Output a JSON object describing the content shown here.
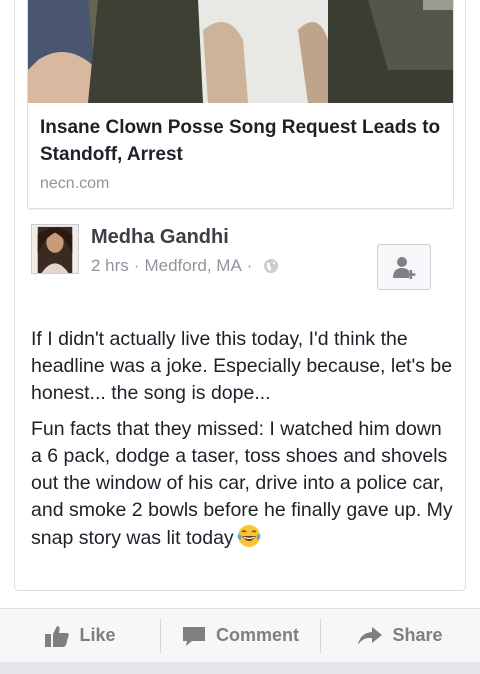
{
  "link_preview": {
    "title": "Insane Clown Posse Song Request Leads to Standoff, Arrest",
    "domain": "necn.com"
  },
  "post": {
    "author": "Medha Gandhi",
    "time": "2 hrs",
    "location": "Medford, MA",
    "separator": "·",
    "paragraphs": [
      "If I didn't actually live this today, I'd think the headline was a joke. Especially because, let's be honest... the song is dope...",
      "Fun facts that they missed: I watched him down a 6 pack, dodge a taser, toss shoes and shovels out the window of his car, drive into a police car, and smoke 2 bowls before he finally gave up. My snap story was lit today"
    ],
    "emoji": "laughing-with-tears-emoji"
  },
  "actions": {
    "like": "Like",
    "comment": "Comment",
    "share": "Share"
  },
  "icons": {
    "follow": "add-friend-icon",
    "privacy": "globe-icon",
    "like": "thumbs-up-icon",
    "comment": "comment-bubble-icon",
    "share": "share-arrow-icon"
  },
  "colors": {
    "text_primary": "#1d2129",
    "text_secondary": "#90949c",
    "action_text": "#7f7f7f",
    "border": "#dddfe2"
  }
}
